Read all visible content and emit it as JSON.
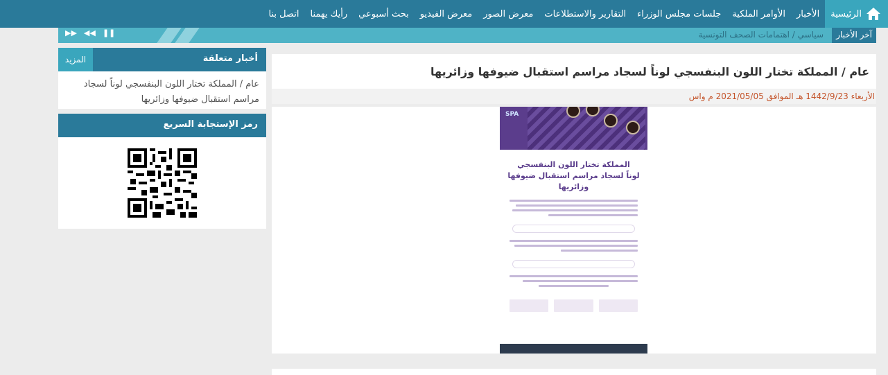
{
  "nav": {
    "items": [
      {
        "label": "الرئيسية",
        "icon": "home-icon",
        "active": true
      },
      {
        "label": "الأخبار"
      },
      {
        "label": "الأوامر الملكية"
      },
      {
        "label": "جلسات مجلس الوزراء"
      },
      {
        "label": "التقارير والاستطلاعات"
      },
      {
        "label": "معرض الصور"
      },
      {
        "label": "معرض الفيديو"
      },
      {
        "label": "بحث أسبوعي"
      },
      {
        "label": "رأيك يهمنا"
      },
      {
        "label": "اتصل بنا"
      }
    ]
  },
  "ticker": {
    "label": "آخر الأخبار",
    "text": "سياسي / اهتمامات الصحف التونسية",
    "controls": [
      "❚❚",
      "◀◀",
      "▶▶"
    ]
  },
  "article": {
    "title": "عام / المملكة تختار اللون البنفسجي لوناً لسجاد مراسم استقبال ضيوفها وزائريها",
    "meta": "الأربعاء 1442/9/23 هـ الموافق 2021/05/05 م واس",
    "poster": {
      "logo": "SPA",
      "heading_line1": "المملكة تختار اللون البنفسجي",
      "heading_line2": "لوناً لسجاد مراسم استقبال ضيوفها وزائريها"
    }
  },
  "sidebar": {
    "related": {
      "title": "أخبار متعلقة",
      "more": "المزيد",
      "item": "عام / المملكة تختار اللون البنفسجي لوناً لسجاد مراسم استقبال ضيوفها وزائريها"
    },
    "qr": {
      "title": "رمز الإستجابة السريع"
    }
  },
  "colors": {
    "primary": "#2a7a9a",
    "accent": "#3aa6bd",
    "ticker": "#4fb3c6",
    "meta": "#c4542a",
    "poster": "#5b3d8c"
  }
}
